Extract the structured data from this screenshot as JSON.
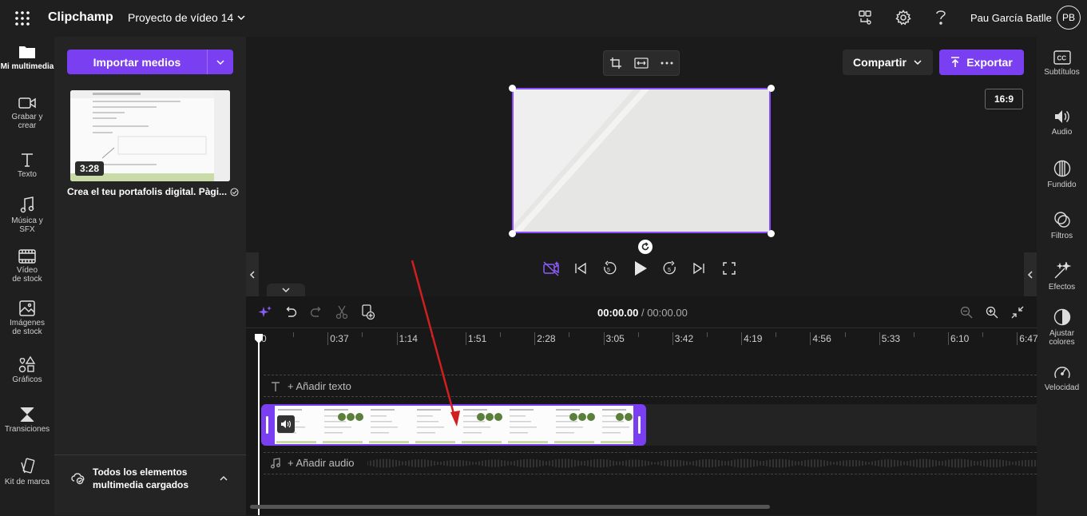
{
  "app": {
    "name": "Clipchamp",
    "project_title": "Proyecto de vídeo 14",
    "user_name": "Pau García Batlle",
    "user_initials": "PB"
  },
  "left_rail": [
    {
      "label": "Mi multimedia",
      "icon": "folder-icon"
    },
    {
      "label": "Grabar y crear",
      "icon": "camera-icon"
    },
    {
      "label": "Texto",
      "icon": "text-icon"
    },
    {
      "label": "Música y SFX",
      "icon": "music-icon"
    },
    {
      "label": "Vídeo de stock",
      "icon": "film-icon"
    },
    {
      "label": "Imágenes de stock",
      "icon": "image-icon"
    },
    {
      "label": "Gráficos",
      "icon": "shapes-icon"
    },
    {
      "label": "Transiciones",
      "icon": "transition-icon"
    },
    {
      "label": "Kit de marca",
      "icon": "brand-kit-icon"
    }
  ],
  "media_panel": {
    "import_label": "Importar medios",
    "items": [
      {
        "duration": "3:28",
        "title": "Crea el teu portafolis digital. Pàgi..."
      }
    ],
    "footer_status": "Todos los elementos multimedia cargados"
  },
  "preview": {
    "share_label": "Compartir",
    "export_label": "Exportar",
    "aspect_ratio": "16:9"
  },
  "right_rail": [
    {
      "label": "Subtítulos",
      "icon": "captions-icon"
    },
    {
      "label": "Audio",
      "icon": "speaker-icon"
    },
    {
      "label": "Fundido",
      "icon": "fade-icon"
    },
    {
      "label": "Filtros",
      "icon": "filters-icon"
    },
    {
      "label": "Efectos",
      "icon": "magic-wand-icon"
    },
    {
      "label": "Ajustar colores",
      "icon": "contrast-icon"
    },
    {
      "label": "Velocidad",
      "icon": "speedometer-icon"
    }
  ],
  "timeline": {
    "current_time": "00:00.00",
    "separator": "/",
    "total_time": "00:00.00",
    "ruler": [
      "0",
      "0:37",
      "1:14",
      "1:51",
      "2:28",
      "3:05",
      "3:42",
      "4:19",
      "4:56",
      "5:33",
      "6:10",
      "6:47"
    ],
    "add_text_label": "+ Añadir texto",
    "add_audio_label": "+ Añadir audio"
  },
  "colors": {
    "accent": "#7b3ff2",
    "background": "#1f1f1f",
    "annotation_arrow": "#d11f1f"
  }
}
